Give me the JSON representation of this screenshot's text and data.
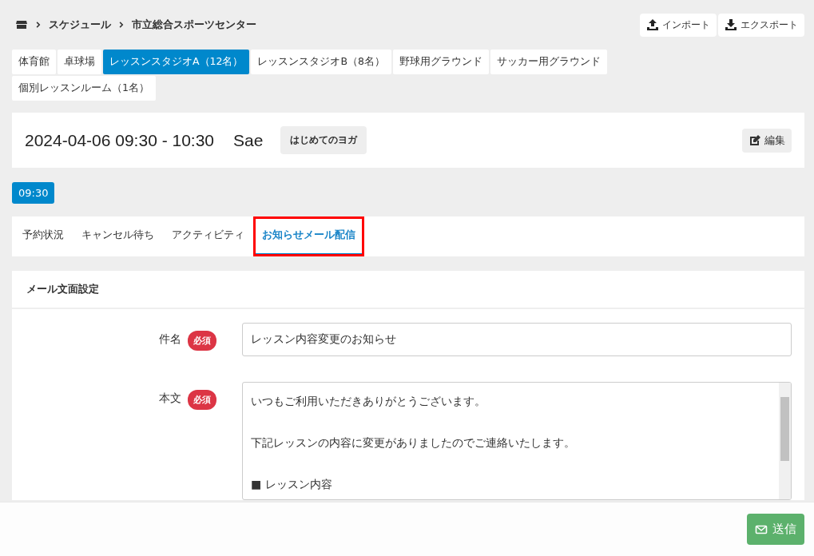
{
  "breadcrumb": {
    "items": [
      "スケジュール",
      "市立総合スポーツセンター"
    ]
  },
  "header_buttons": [
    {
      "kind": "upload",
      "label": "インポート"
    },
    {
      "kind": "download",
      "label": "エクスポート"
    }
  ],
  "facility_tabs": [
    {
      "label": "体育館",
      "selected": false
    },
    {
      "label": "卓球場",
      "selected": false
    },
    {
      "label": "レッスンスタジオA（12名）",
      "selected": true
    },
    {
      "label": "レッスンスタジオB（8名）",
      "selected": false
    },
    {
      "label": "野球用グラウンド",
      "selected": false
    },
    {
      "label": "サッカー用グラウンド",
      "selected": false
    },
    {
      "label": "個別レッスンルーム（1名）",
      "selected": false
    }
  ],
  "event": {
    "datetime": "2024-04-06 09:30 - 10:30",
    "instructor": "Sae",
    "lesson": "はじめてのヨガ",
    "edit_button": "編集"
  },
  "time_slots": [
    {
      "label": "09:30",
      "selected": true
    }
  ],
  "detail_tabs": [
    {
      "label": "予約状況",
      "selected": false,
      "highlighted": false
    },
    {
      "label": "キャンセル待ち",
      "selected": false,
      "highlighted": false
    },
    {
      "label": "アクティビティ",
      "selected": false,
      "highlighted": false
    },
    {
      "label": "お知らせメール配信",
      "selected": true,
      "highlighted": true
    }
  ],
  "mail_form": {
    "title": "メール文面設定",
    "fields": [
      {
        "kind": "input",
        "label": "件名",
        "required_badge": "必須",
        "value": "レッスン内容変更のお知らせ"
      },
      {
        "kind": "textarea",
        "label": "本文",
        "required_badge": "必須",
        "paragraphs": [
          "いつもご利用いただきありがとうございます。",
          "下記レッスンの内容に変更がありましたのでご連絡いたします。",
          "■ レッスン内容"
        ]
      }
    ]
  },
  "footer": {
    "send_button": "送信",
    "send_disabled": true
  }
}
